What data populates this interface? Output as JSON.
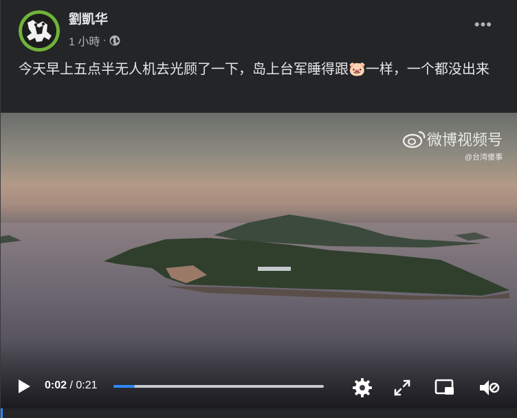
{
  "post": {
    "author": "劉凱华",
    "time": "1 小時",
    "separator": "·",
    "more": "•••",
    "text_before_emoji": "今天早上五点半无人机去光顾了一下，岛上台军睡得跟",
    "emoji": "🐷",
    "text_after_emoji": "一样，一个都没出来"
  },
  "video": {
    "watermark_main": "微博视频号",
    "watermark_sub": "@台湾傻事",
    "current_time": "0:02",
    "time_separator": "/",
    "duration": "0:21",
    "progress": 0.1
  },
  "icons": {
    "avatar": "frog-logo",
    "audience": "globe-icon",
    "watermark_logo": "weibo-icon",
    "play": "play-icon",
    "settings": "gear-icon",
    "fullscreen": "expand-icon",
    "pip": "picture-in-picture-icon",
    "mute": "volume-muted-icon"
  },
  "colors": {
    "card": "#242526",
    "text": "#e4e6eb",
    "muted": "#b0b3b8",
    "progress": "#2d88ff"
  }
}
